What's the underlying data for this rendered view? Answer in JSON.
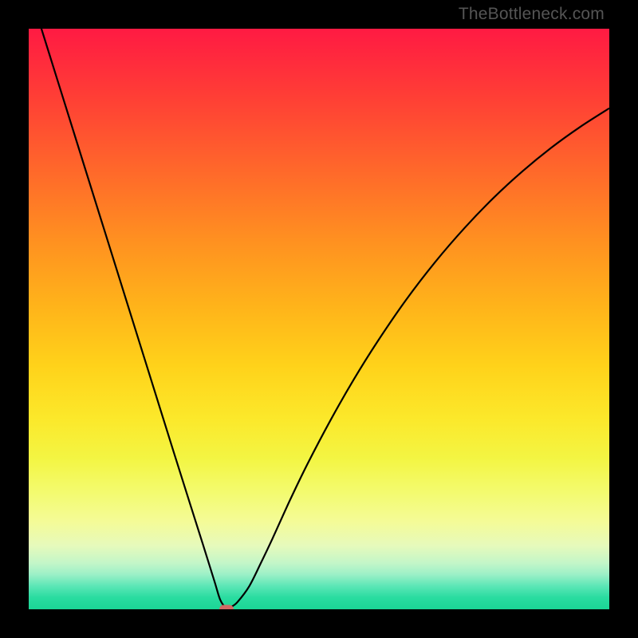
{
  "watermark": "TheBottleneck.com",
  "colors": {
    "frame": "#000000",
    "curve": "#000000",
    "marker": "#d16a65",
    "watermark": "#555555"
  },
  "gradient_stops": [
    {
      "pct": 0,
      "hex": "#ff1a43"
    },
    {
      "pct": 12,
      "hex": "#ff3f35"
    },
    {
      "pct": 25,
      "hex": "#ff6a2a"
    },
    {
      "pct": 37,
      "hex": "#ff9220"
    },
    {
      "pct": 48,
      "hex": "#ffb41a"
    },
    {
      "pct": 58,
      "hex": "#ffd21a"
    },
    {
      "pct": 67,
      "hex": "#fce82a"
    },
    {
      "pct": 74,
      "hex": "#f3f543"
    },
    {
      "pct": 80,
      "hex": "#f3fb70"
    },
    {
      "pct": 85,
      "hex": "#f4fb98"
    },
    {
      "pct": 89,
      "hex": "#e6fabb"
    },
    {
      "pct": 92,
      "hex": "#c4f6c8"
    },
    {
      "pct": 94,
      "hex": "#9cf0c7"
    },
    {
      "pct": 96,
      "hex": "#5ce6b6"
    },
    {
      "pct": 98,
      "hex": "#29dca0"
    },
    {
      "pct": 100,
      "hex": "#1bd695"
    }
  ],
  "chart_data": {
    "type": "line",
    "title": "",
    "xlabel": "",
    "ylabel": "",
    "xlim": [
      0,
      100
    ],
    "ylim": [
      0,
      100
    ],
    "x": [
      0,
      5,
      10,
      15,
      20,
      25,
      28,
      30,
      32,
      33,
      34,
      35,
      36,
      38,
      40,
      42,
      45,
      48,
      52,
      56,
      60,
      65,
      70,
      75,
      80,
      85,
      90,
      95,
      100
    ],
    "values": [
      107,
      91,
      75,
      59,
      43,
      27,
      17.5,
      11.2,
      4.8,
      1.6,
      0.3,
      0.5,
      1.3,
      4,
      8,
      12.2,
      18.8,
      25,
      32.6,
      39.6,
      46,
      53.3,
      59.8,
      65.6,
      70.8,
      75.4,
      79.5,
      83.1,
      86.3
    ],
    "optimal_point": {
      "x": 34,
      "y": 0
    },
    "note": "Values are percent of plot height from bottom (0=bottom, 100=top). x is percent of plot width from left. Values estimated from pixel positions; no axis labels or numeric ticks are shown in source image."
  }
}
